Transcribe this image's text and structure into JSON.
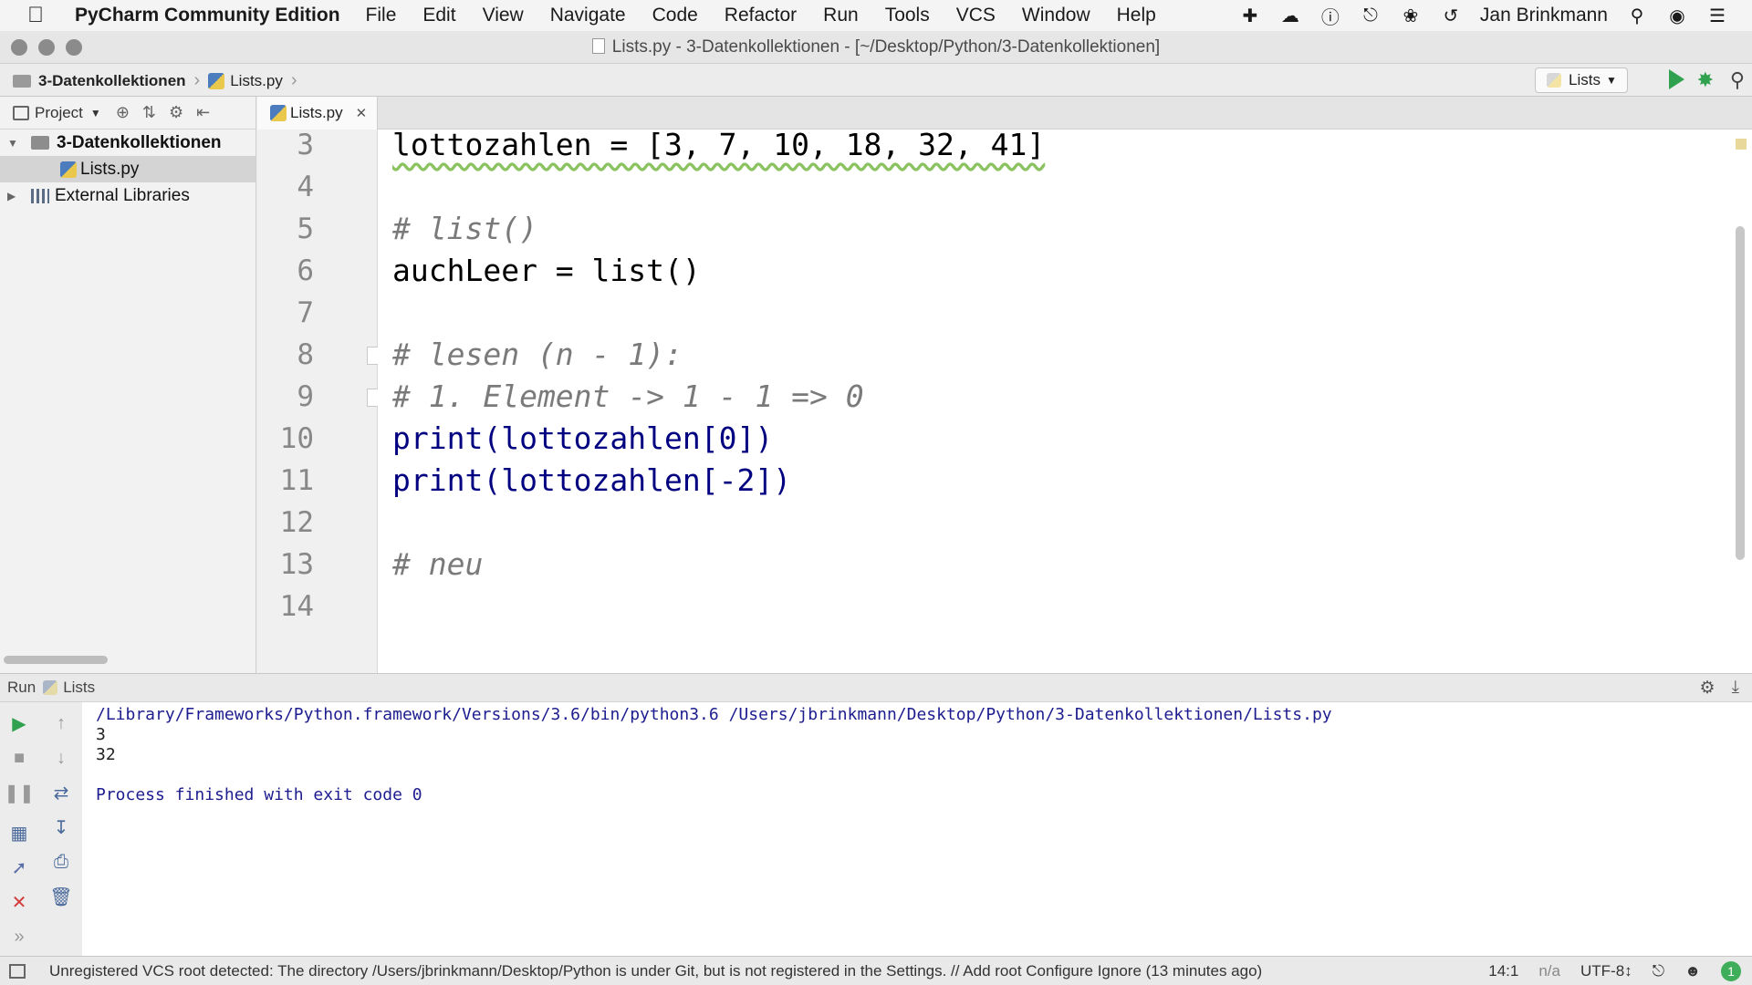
{
  "menubar": {
    "apple_icon": "apple-icon",
    "app_name": "PyCharm Community Edition",
    "items": [
      "File",
      "Edit",
      "View",
      "Navigate",
      "Code",
      "Refactor",
      "Run",
      "Tools",
      "VCS",
      "Window",
      "Help"
    ],
    "user": "Jan Brinkmann"
  },
  "window": {
    "title": "Lists.py - 3-Datenkollektionen - [~/Desktop/Python/3-Datenkollektionen]"
  },
  "navbar": {
    "crumb_project": "3-Datenkollektionen",
    "crumb_file": "Lists.py",
    "run_config": "Lists"
  },
  "project_pane": {
    "title": "Project",
    "root": "3-Datenkollektionen",
    "file": "Lists.py",
    "external": "External Libraries"
  },
  "editor": {
    "tab_label": "Lists.py",
    "lines": [
      {
        "n": "3",
        "code": "lottozahlen = [3, 7, 10, 18, 32, 41]"
      },
      {
        "n": "4",
        "code": ""
      },
      {
        "n": "5",
        "code": "# list()"
      },
      {
        "n": "6",
        "code": "auchLeer = list()"
      },
      {
        "n": "7",
        "code": ""
      },
      {
        "n": "8",
        "code": "# lesen (n - 1):"
      },
      {
        "n": "9",
        "code": "# 1. Element -> 1 - 1 => 0"
      },
      {
        "n": "10",
        "code": "print(lottozahlen[0])"
      },
      {
        "n": "11",
        "code": "print(lottozahlen[-2])"
      },
      {
        "n": "12",
        "code": ""
      },
      {
        "n": "13",
        "code": "# neu"
      },
      {
        "n": "14",
        "code": ""
      }
    ]
  },
  "run_pane": {
    "label": "Run",
    "config": "Lists",
    "command": "/Library/Frameworks/Python.framework/Versions/3.6/bin/python3.6 /Users/jbrinkmann/Desktop/Python/3-Datenkollektionen/Lists.py",
    "output": [
      "3",
      "32"
    ],
    "finished": "Process finished with exit code 0"
  },
  "statusbar": {
    "message": "Unregistered VCS root detected: The directory /Users/jbrinkmann/Desktop/Python is under Git, but is not registered in the Settings. // Add root  Configure  Ignore (13 minutes ago)",
    "position": "14:1",
    "na": "n/a",
    "encoding": "UTF-8↕",
    "badge": "1"
  }
}
